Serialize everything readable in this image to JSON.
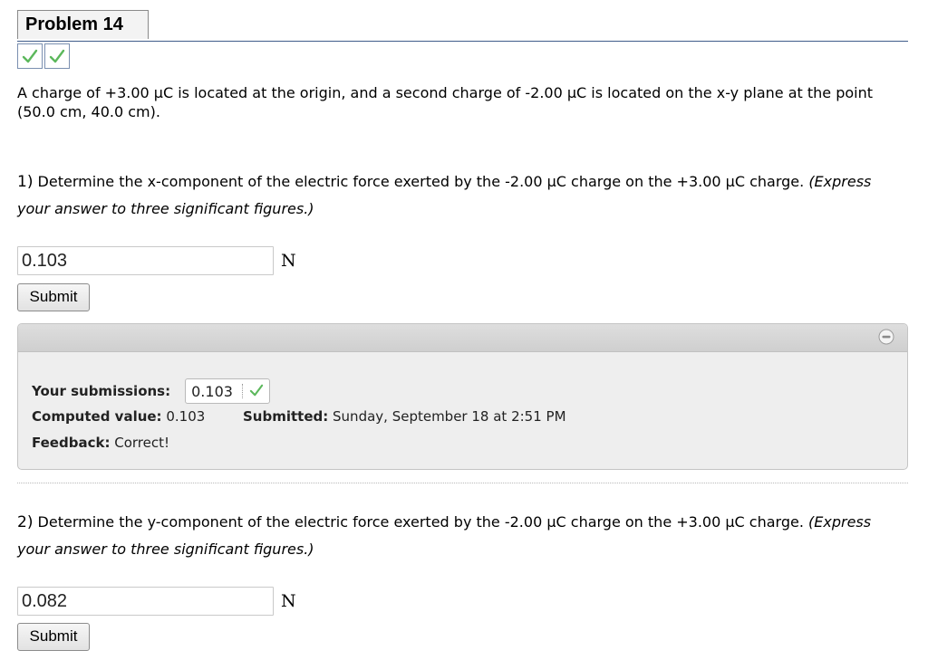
{
  "problem": {
    "title": "Problem 14",
    "statement": "A charge of +3.00 μC is located at the origin, and a second charge of -2.00 μC is located on the x-y plane at the point (50.0 cm, 40.0 cm)."
  },
  "status_checks": [
    "checkmark",
    "checkmark"
  ],
  "parts": [
    {
      "number": "1)",
      "text": "Determine the x-component of the electric force exerted by the -2.00 μC charge on the +3.00 μC charge.",
      "hint": "(Express your answer to three significant figures.)",
      "answer_value": "0.103",
      "unit": "N",
      "submit_label": "Submit"
    },
    {
      "number": "2)",
      "text": "Determine the y-component of the electric force exerted by the -2.00 μC charge on the +3.00 μC charge.",
      "hint": "(Express your answer to three significant figures.)",
      "answer_value": "0.082",
      "unit": "N",
      "submit_label": "Submit"
    }
  ],
  "result": {
    "submissions_label": "Your submissions:",
    "submission_value": "0.103",
    "computed_label": "Computed value:",
    "computed_value": "0.103",
    "submitted_label": "Submitted:",
    "submitted_value": "Sunday, September 18 at 2:51 PM",
    "feedback_label": "Feedback:",
    "feedback_value": "Correct!"
  },
  "colors": {
    "check_green": "#5cb85c",
    "header_rule": "#3f5c8a",
    "panel_bg": "#eeeeee"
  }
}
